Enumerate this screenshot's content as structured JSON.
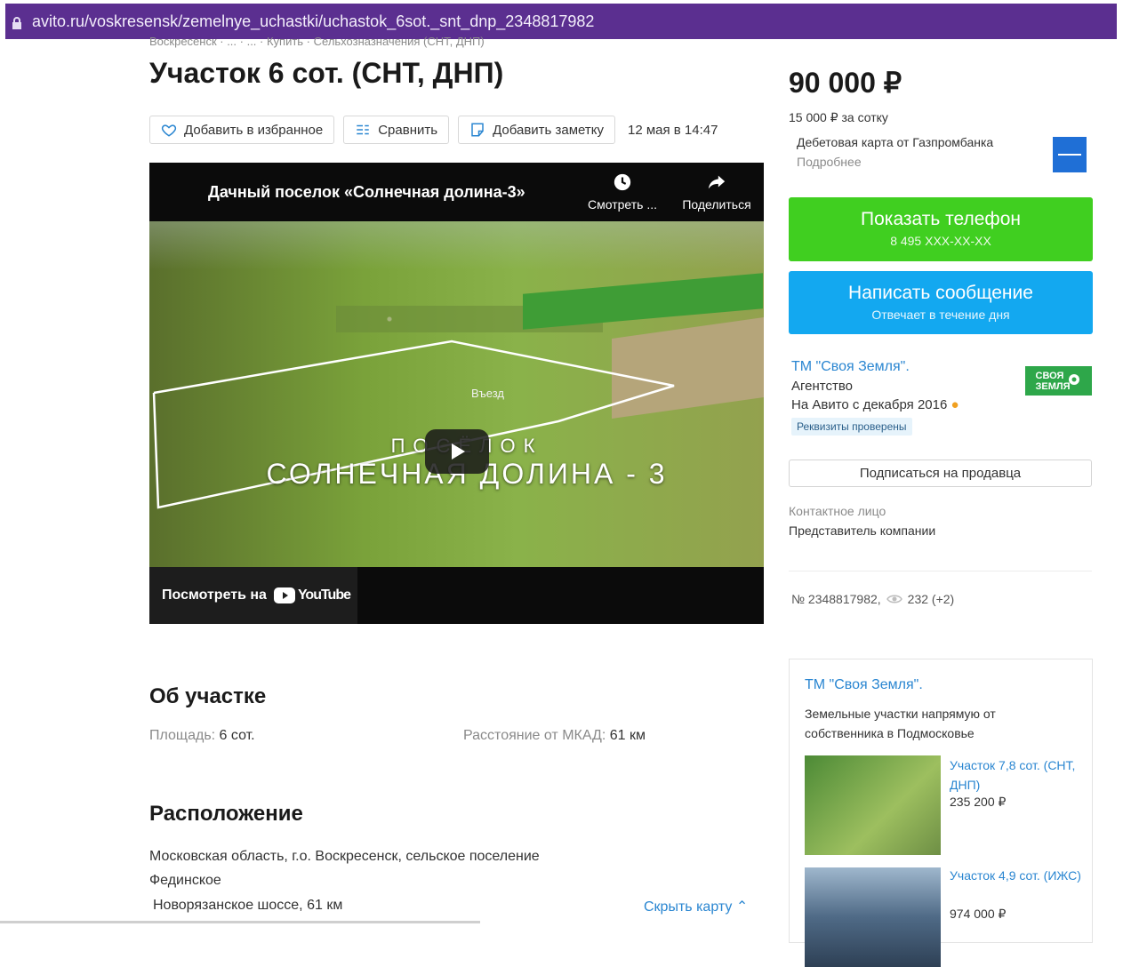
{
  "browser": {
    "url": "avito.ru/voskresensk/zemelnye_uchastki/uchastok_6sot._snt_dnp_2348817982",
    "lock_icon": "lock-icon"
  },
  "breadcrumbs": "Воскресенск · ... · ... · Купить · Сельхозназначения (СНТ, ДНП)",
  "listing": {
    "title": "Участок 6 сот. (СНТ, ДНП)",
    "actions": {
      "favorite": "Добавить в избранное",
      "compare": "Сравнить",
      "note": "Добавить заметку"
    },
    "date": "12 мая в 14:47"
  },
  "video": {
    "title": "Дачный поселок «Солнечная долина-3»",
    "watch_later": "Смотреть ...",
    "share": "Поделиться",
    "overlay_line1": "ПОСЁЛОК",
    "overlay_line2": "СОЛНЕЧНАЯ ДОЛИНА - 3",
    "entry_label": "Въезд",
    "watch_on": "Посмотреть на",
    "youtube": "YouTube"
  },
  "about": {
    "heading": "Об участке",
    "area_label": "Площадь:",
    "area_value": "6 сот.",
    "distance_label": "Расстояние от МКАД:",
    "distance_value": "61 км"
  },
  "location": {
    "heading": "Расположение",
    "address_line1": "Московская область, г.о. Воскресенск, сельское поселение",
    "address_line2": "Фединское",
    "road": "Новорязанское шоссе, 61 км",
    "hide_map": "Скрыть карту"
  },
  "sidebar": {
    "price": "90 000 ₽",
    "price_per": "15 000 ₽ за сотку",
    "ad_text": "Дебетовая карта от Газпромбанка",
    "ad_more": "Подробнее",
    "show_phone": "Показать телефон",
    "phone_masked": "8 495 XXX-XX-XX",
    "write_message": "Написать сообщение",
    "reply_time": "Отвечает в течение дня",
    "seller_name": "ТМ \"Своя Земля\".",
    "seller_type": "Агентство",
    "on_avito": "На Авито с декабря 2016",
    "verified": "Реквизиты проверены",
    "brand_logo_text": "СВОЯ ЗЕМЛЯ",
    "subscribe": "Подписаться на продавца",
    "contact_label": "Контактное лицо",
    "contact_value": "Представитель компании",
    "ad_number": "№ 2348817982,",
    "views": "232 (+2)"
  },
  "widget": {
    "name": "ТМ \"Своя Земля\".",
    "description": "Земельные участки напрямую от собственника в Подмосковье",
    "items": [
      {
        "title": "Участок 7,8 сот. (СНТ, ДНП)",
        "price": "235 200 ₽"
      },
      {
        "title": "Участок 4,9 сот. (ИЖС)",
        "price": "974 000 ₽"
      }
    ]
  },
  "colors": {
    "browser_bar": "#5b2f90",
    "green_button": "#40cf20",
    "blue_button": "#13a8f0",
    "link": "#2a86d1"
  }
}
